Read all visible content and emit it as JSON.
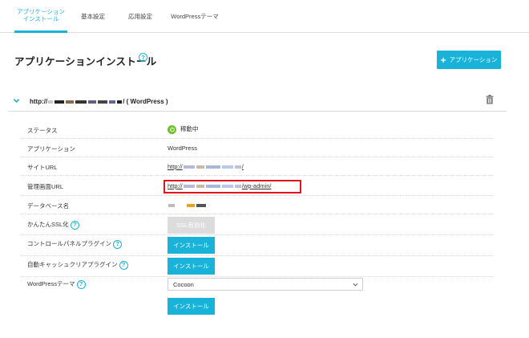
{
  "tabs": [
    {
      "line1": "アプリケーション",
      "line2": "インストール"
    },
    {
      "label": "基本設定"
    },
    {
      "label": "応用設定"
    },
    {
      "label": "WordPressテーマ"
    }
  ],
  "header": {
    "title": "アプリケーションインストール",
    "help": "?",
    "add_button_plus": "+",
    "add_button_label": "アプリケーション"
  },
  "app": {
    "url_prefix": "http://",
    "url_suffix": "/ ( WordPress )"
  },
  "rows": {
    "status": {
      "label": "ステータス",
      "value": "稼動中"
    },
    "application": {
      "label": "アプリケーション",
      "value": "WordPress"
    },
    "site_url": {
      "label": "サイトURL",
      "prefix": "http://",
      "suffix": "/"
    },
    "admin_url": {
      "label": "管理画面URL",
      "prefix": "http://",
      "suffix": "/wp-admin/"
    },
    "db_name": {
      "label": "データベース名"
    },
    "ssl": {
      "label": "かんたんSSL化",
      "button": "SSL有効化"
    },
    "cp_plugin": {
      "label": "コントロールパネルプラグイン",
      "button": "インストール"
    },
    "cache_plugin": {
      "label": "自動キャッシュクリアプラグイン",
      "button": "インストール"
    },
    "theme": {
      "label": "WordPressテーマ",
      "selected": "Cocoon",
      "button": "インストール"
    }
  },
  "colors": {
    "accent": "#19b2d8",
    "link": "#1a73c8",
    "running": "#6cbf2a",
    "highlight": "#e0141c",
    "disabled": "#dcdcdc"
  },
  "icons": {
    "collapse": "chevron-down-icon",
    "delete": "trash-icon",
    "status": "power-icon",
    "select": "chevron-down-icon"
  }
}
